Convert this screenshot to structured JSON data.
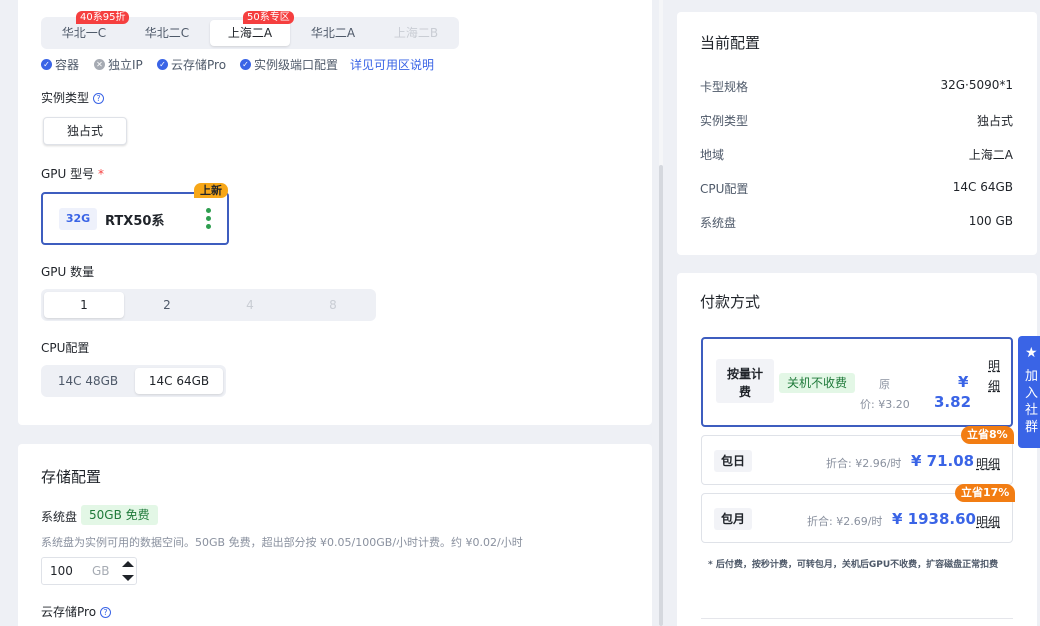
{
  "region": {
    "tabs": [
      {
        "label": "华北一C",
        "badge": "40系95折",
        "state": "normal"
      },
      {
        "label": "华北二C",
        "badge": "",
        "state": "normal"
      },
      {
        "label": "上海二A",
        "badge": "50系专区",
        "state": "active"
      },
      {
        "label": "华北二A",
        "badge": "",
        "state": "normal"
      },
      {
        "label": "上海二B",
        "badge": "",
        "state": "disabled"
      }
    ],
    "features": [
      {
        "label": "容器",
        "available": true
      },
      {
        "label": "独立IP",
        "available": false
      },
      {
        "label": "云存储Pro",
        "available": true
      },
      {
        "label": "实例级端口配置",
        "available": true
      }
    ],
    "details_link": "详见可用区说明"
  },
  "instance_type": {
    "label": "实例类型",
    "option": "独占式"
  },
  "gpu_model": {
    "label": "GPU 型号",
    "required_mark": "*",
    "card": {
      "memory": "32G",
      "name": "RTX50系",
      "new_badge": "上新"
    }
  },
  "gpu_count": {
    "label": "GPU 数量",
    "options": [
      {
        "label": "1",
        "state": "active"
      },
      {
        "label": "2",
        "state": "normal"
      },
      {
        "label": "4",
        "state": "disabled"
      },
      {
        "label": "8",
        "state": "disabled"
      }
    ]
  },
  "cpu_config": {
    "label": "CPU配置",
    "options": [
      {
        "label": "14C 48GB",
        "state": "normal"
      },
      {
        "label": "14C 64GB",
        "state": "active"
      }
    ]
  },
  "storage": {
    "title": "存储配置",
    "system_disk_label": "系统盘",
    "free_tag": "50GB 免费",
    "description": "系统盘为实例可用的数据空间。50GB 免费，超出部分按 ¥0.05/100GB/小时计费。约 ¥0.02/小时",
    "value": "100",
    "unit": "GB",
    "cloud_storage_label": "云存储Pro"
  },
  "current_config": {
    "title": "当前配置",
    "rows": [
      {
        "label": "卡型规格",
        "value": "32G·5090*1"
      },
      {
        "label": "实例类型",
        "value": "独占式"
      },
      {
        "label": "地域",
        "value": "上海二A"
      },
      {
        "label": "CPU配置",
        "value": "14C 64GB"
      },
      {
        "label": "系统盘",
        "value": "100 GB"
      }
    ]
  },
  "payment": {
    "title": "付款方式",
    "hourly": {
      "name_line1": "按量计",
      "name_line2": "费",
      "tag": "关机不收费",
      "orig_label_1": "原",
      "orig_label_2": "价: ¥3.20",
      "currency": "¥",
      "price": "3.82",
      "detail_1": "明",
      "detail_2": "细"
    },
    "daily": {
      "name": "包日",
      "save": "立省8%",
      "equiv": "折合: ¥2.96/时",
      "price": "¥ 71.08",
      "detail": "明细"
    },
    "monthly": {
      "name": "包月",
      "save": "立省17%",
      "equiv": "折合: ¥2.69/时",
      "price": "¥ 1938.60",
      "detail": "明细"
    },
    "note": "* 后付费，按秒计费，可转包月，关机后GPU不收费，扩容磁盘正常扣费"
  },
  "float_tab": {
    "text": "加入社群"
  },
  "colors": {
    "accent": "#3a64e6",
    "success": "#2e9e4f",
    "danger": "#f53f3f",
    "warning": "#f27d13"
  }
}
